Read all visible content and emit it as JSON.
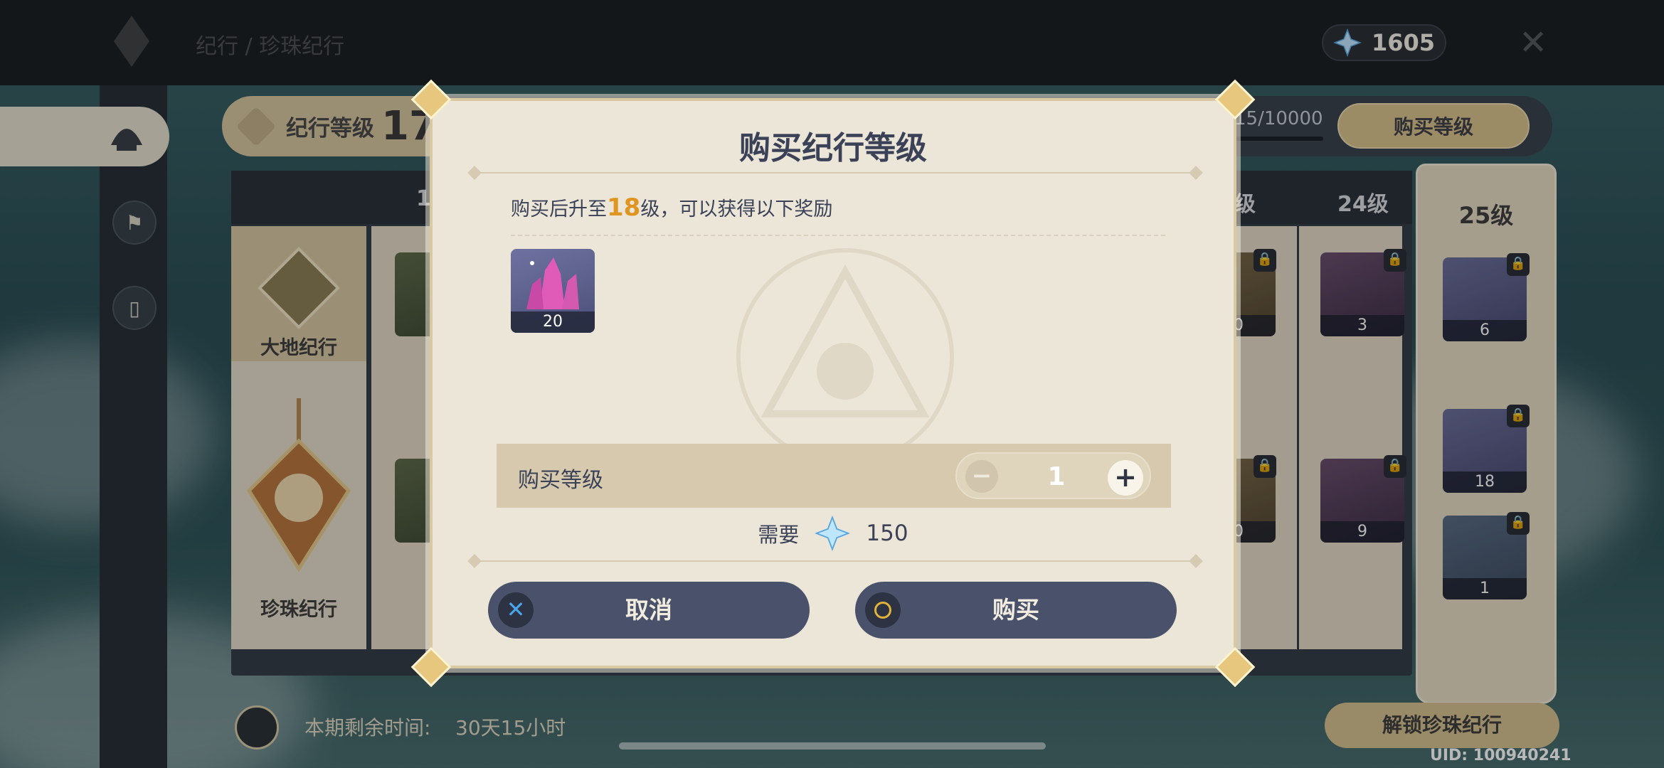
{
  "top_bar": {
    "breadcrumb": "纪行 / 珍珠纪行",
    "currency_amount": "1605",
    "currency_icon": "primogem-icon",
    "close_icon": "close-icon"
  },
  "background": {
    "level_label": "纪行等级",
    "level_value": "17",
    "exp_text": "15/10000",
    "buy_level_button": "购买等级",
    "columns": [
      "17",
      "级",
      "24级",
      "25级"
    ],
    "lanes": {
      "free": "大地纪行",
      "paid": "珍珠纪行"
    },
    "rewards_24": [
      "3",
      "9"
    ],
    "rewards_23": [
      "00",
      "00"
    ],
    "rewards_25": [
      "6",
      "18",
      "1"
    ],
    "remaining_label": "本期剩余时间:",
    "remaining_value": "30天15小时",
    "unlock_button": "解锁珍珠纪行",
    "uid": "UID: 100940241"
  },
  "dialog": {
    "title": "购买纪行等级",
    "desc_prefix": "购买后升至",
    "desc_level": "18",
    "desc_suffix": "级，可以获得以下奖励",
    "reward_qty": "20",
    "reward_icon": "crystal-icon",
    "quantity_label": "购买等级",
    "quantity_value": "1",
    "cost_label": "需要",
    "cost_value": "150",
    "cancel_label": "取消",
    "buy_label": "购买"
  },
  "colors": {
    "accent_gold": "#e09520",
    "button_dark": "#49526a",
    "dialog_bg": "#ece6d8"
  }
}
